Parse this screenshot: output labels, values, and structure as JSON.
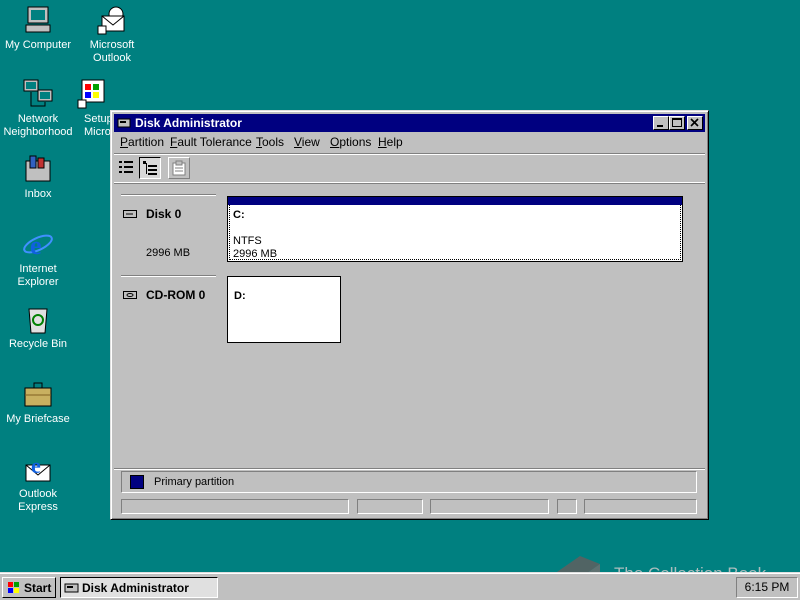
{
  "desktop": {
    "icons": [
      {
        "label": "My Computer",
        "icon": "my-computer-icon"
      },
      {
        "label": "Microsoft\nOutlook",
        "icon": "outlook-icon"
      },
      {
        "label": "Network\nNeighborhood",
        "icon": "network-icon"
      },
      {
        "label": "Setup\nMicrosoft",
        "icon": "setup-icon"
      },
      {
        "label": "Inbox",
        "icon": "inbox-icon"
      },
      {
        "label": "Internet\nExplorer",
        "icon": "ie-icon"
      },
      {
        "label": "Recycle Bin",
        "icon": "recycle-bin-icon"
      },
      {
        "label": "My Briefcase",
        "icon": "briefcase-icon"
      },
      {
        "label": "Outlook\nExpress",
        "icon": "outlook-express-icon"
      }
    ]
  },
  "window": {
    "title": "Disk Administrator",
    "menu": [
      {
        "label": "Partition",
        "accel": "P",
        "rest": "artition"
      },
      {
        "label": "Fault Tolerance",
        "accel": "F",
        "rest": "ault Tolerance"
      },
      {
        "label": "Tools",
        "accel": "T",
        "rest": "ools"
      },
      {
        "label": "View",
        "accel": "V",
        "rest": "iew"
      },
      {
        "label": "Options",
        "accel": "O",
        "rest": "ptions"
      },
      {
        "label": "Help",
        "accel": "H",
        "rest": "elp"
      }
    ],
    "disks": [
      {
        "name": "Disk 0",
        "size": "2996 MB",
        "partition": {
          "letter": "C:",
          "fs": "NTFS",
          "size": "2996 MB",
          "selected": true
        }
      },
      {
        "name": "CD-ROM 0",
        "size": "",
        "partition": {
          "letter": "D:",
          "fs": "",
          "size": "",
          "selected": false
        }
      }
    ],
    "legend": {
      "label": "Primary partition",
      "color": "#000080"
    }
  },
  "taskbar": {
    "start_label": "Start",
    "task_label": "Disk Administrator",
    "clock": "6:15 PM"
  },
  "watermark": "The Collection Book"
}
